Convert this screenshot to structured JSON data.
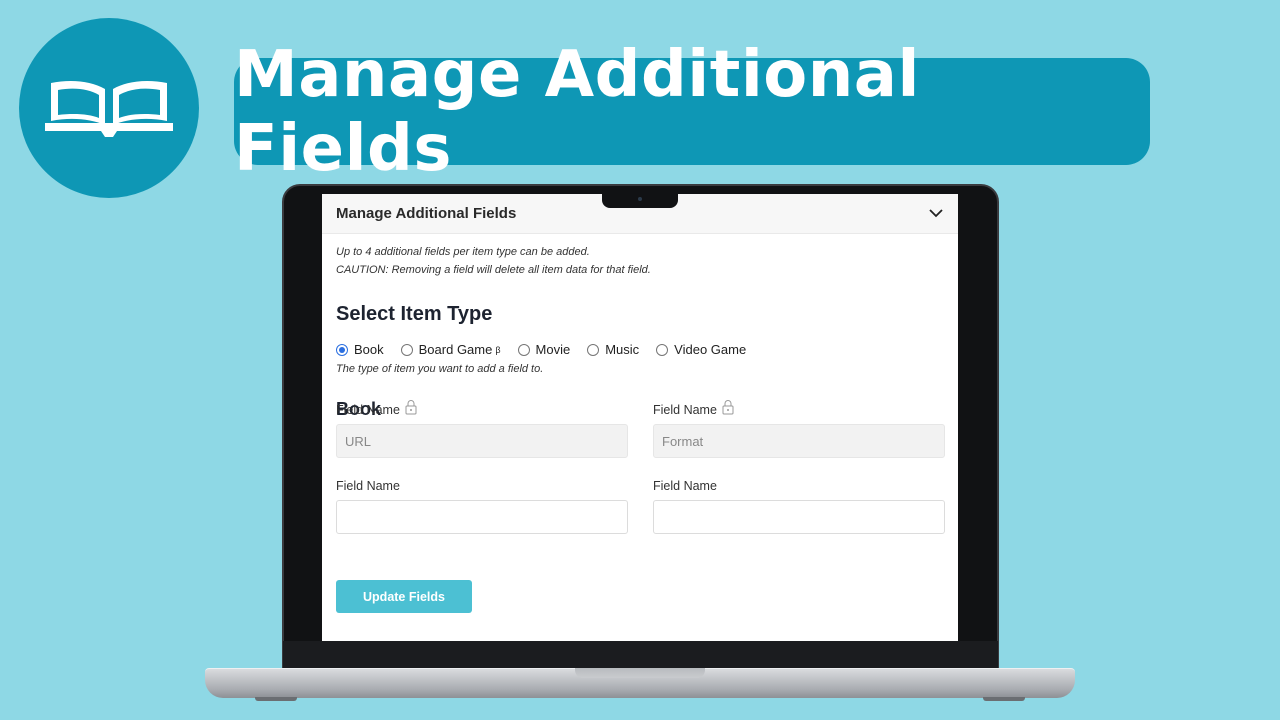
{
  "banner": {
    "title": "Manage Additional Fields",
    "logo_icon": "open-book-icon",
    "color": "#0e97b5"
  },
  "panel": {
    "title": "Manage Additional Fields",
    "collapse_icon": "chevron-down-icon",
    "notes": [
      "Up to 4 additional fields per item type can be added.",
      "CAUTION: Removing a field will delete all item data for that field."
    ]
  },
  "item_type": {
    "heading": "Select Item Type",
    "options": [
      {
        "label": "Book",
        "checked": true,
        "sup": ""
      },
      {
        "label": "Board Game",
        "checked": false,
        "sup": "β"
      },
      {
        "label": "Movie",
        "checked": false,
        "sup": ""
      },
      {
        "label": "Music",
        "checked": false,
        "sup": ""
      },
      {
        "label": "Video Game",
        "checked": false,
        "sup": ""
      }
    ],
    "hint": "The type of item you want to add a field to."
  },
  "book": {
    "heading": "Book",
    "fields": [
      {
        "label": "Field Name",
        "locked": true,
        "value": "URL",
        "placeholder": ""
      },
      {
        "label": "Field Name",
        "locked": true,
        "value": "Format",
        "placeholder": ""
      },
      {
        "label": "Field Name",
        "locked": false,
        "value": "",
        "placeholder": ""
      },
      {
        "label": "Field Name",
        "locked": false,
        "value": "",
        "placeholder": ""
      }
    ]
  },
  "actions": {
    "update_label": "Update Fields",
    "update_color": "#4cc0d3"
  }
}
